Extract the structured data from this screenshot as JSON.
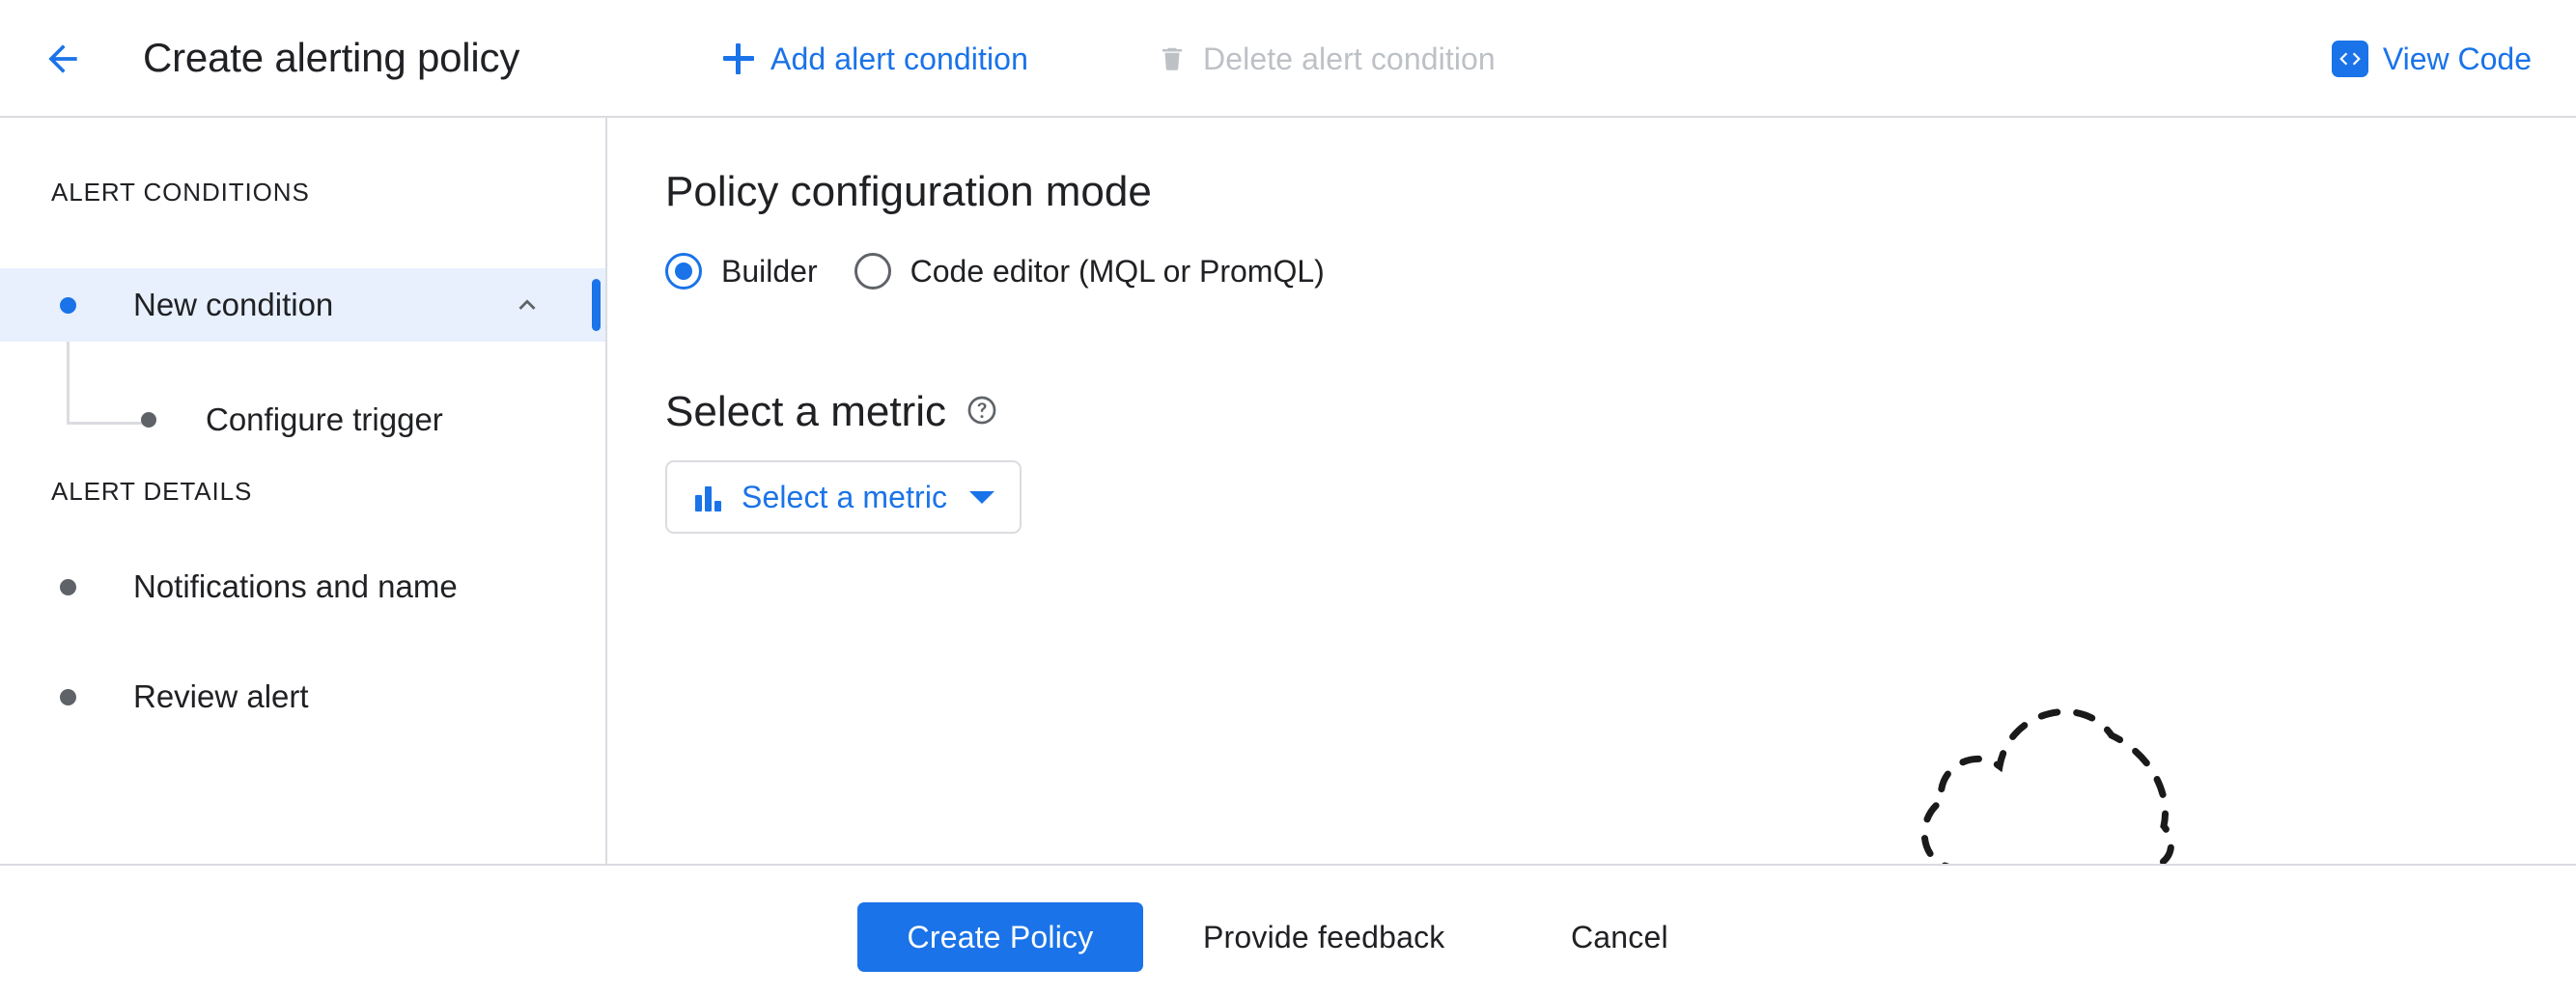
{
  "header": {
    "back_icon": "arrow-left-icon",
    "title": "Create alerting policy",
    "add_condition": {
      "label": "Add alert condition",
      "icon": "plus-icon",
      "enabled": true
    },
    "delete_condition": {
      "label": "Delete alert condition",
      "icon": "trash-icon",
      "enabled": false
    },
    "view_code": {
      "label": "View Code",
      "icon": "code-brackets-icon"
    }
  },
  "sidebar": {
    "sections": [
      {
        "title": "ALERT CONDITIONS",
        "items": [
          {
            "label": "New condition",
            "selected": true,
            "expanded": true,
            "chevron_icon": "chevron-up-icon"
          },
          {
            "label": "Configure trigger",
            "selected": false,
            "child": true
          }
        ]
      },
      {
        "title": "ALERT DETAILS",
        "items": [
          {
            "label": "Notifications and name",
            "selected": false
          },
          {
            "label": "Review alert",
            "selected": false
          }
        ]
      }
    ]
  },
  "main": {
    "config_mode": {
      "heading": "Policy configuration mode",
      "options": [
        {
          "label": "Builder",
          "checked": true
        },
        {
          "label": "Code editor (MQL or PromQL)",
          "checked": false
        }
      ]
    },
    "select_metric": {
      "heading": "Select a metric",
      "help_icon": "help-circle-icon",
      "button_label": "Select a metric",
      "button_icon": "bar-chart-icon",
      "dropdown_icon": "caret-down-icon"
    },
    "illustration": "dashed-cloud-icon"
  },
  "footer": {
    "create_policy": "Create Policy",
    "provide_feedback": "Provide feedback",
    "cancel": "Cancel"
  },
  "colors": {
    "accent_blue": "#1a73e8",
    "selected_bg": "#e8f0fe",
    "text_primary": "#202124",
    "text_disabled": "#bdc1c6",
    "divider": "#dadce0",
    "dot_grey": "#5f6368"
  }
}
